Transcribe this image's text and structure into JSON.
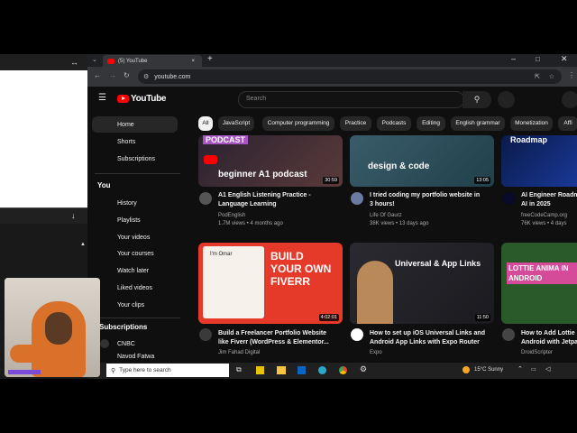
{
  "browser": {
    "tab_title": "(5) YouTube",
    "address": "youtube.com",
    "new_tab_symbol": "+",
    "close_symbol": "×"
  },
  "youtube": {
    "logo_text": "YouTube",
    "search_placeholder": "Search"
  },
  "sidebar": {
    "items_top": [
      {
        "label": "Home",
        "icon": "home-icon"
      },
      {
        "label": "Shorts",
        "icon": "shorts-icon"
      },
      {
        "label": "Subscriptions",
        "icon": "subscriptions-icon"
      }
    ],
    "you_heading": "You",
    "items_you": [
      {
        "label": "History"
      },
      {
        "label": "Playlists"
      },
      {
        "label": "Your videos"
      },
      {
        "label": "Your courses"
      },
      {
        "label": "Watch later"
      },
      {
        "label": "Liked videos"
      },
      {
        "label": "Your clips"
      }
    ],
    "subscriptions_heading": "Subscriptions",
    "channels": [
      {
        "label": "CNBC"
      },
      {
        "label": "Navod Fatwa"
      }
    ]
  },
  "chips": [
    "All",
    "JavaScript",
    "Computer programming",
    "Practice",
    "Podcasts",
    "Editing",
    "English grammar",
    "Monetization",
    "Affi"
  ],
  "videos_row1": [
    {
      "thumb_text": "beginner A1 podcast",
      "thumb_badge": "PODCAST",
      "duration": "30:59",
      "title_line1": "A1 English Listening Practice -",
      "title_line2": "Language Learning",
      "channel": "PodEnglish",
      "stats": "1.7M views • 4 months ago"
    },
    {
      "thumb_text": "design & code",
      "duration": "13:05",
      "title_line1": "I tried coding my portfolio website in",
      "title_line2": "3 hours!",
      "channel": "Life Of Gaurz",
      "stats": "38K views • 13 days ago"
    },
    {
      "thumb_text": "Roadmap",
      "title_line1": "AI Engineer Roadm",
      "title_line2": "AI in 2025",
      "channel": "freeCodeCamp.org",
      "stats": "76K views • 4 days"
    }
  ],
  "videos_row2": [
    {
      "thumb_text": "BUILD YOUR OWN FIVERR",
      "thumb_small": "I'm Omar",
      "duration": "4:02:01",
      "title_line1": "Build a Freelancer Portfolio Website",
      "title_line2": "like Fiverr (WordPress & Elementor...",
      "channel": "Jim Fahad Digital"
    },
    {
      "thumb_text": "Universal & App Links",
      "duration": "11:50",
      "title_line1": "How to set up iOS Universal Links and",
      "title_line2": "Android App Links with Expo Router",
      "channel": "Expo"
    },
    {
      "thumb_text": "LOTTIE ANIMA IN ANDROID",
      "title_line1": "How to Add Lottie",
      "title_line2": "Android with Jetpa",
      "channel": "DroidScripter"
    }
  ],
  "taskbar": {
    "search_placeholder": "Type here to search",
    "weather": "15°C  Sunny"
  }
}
